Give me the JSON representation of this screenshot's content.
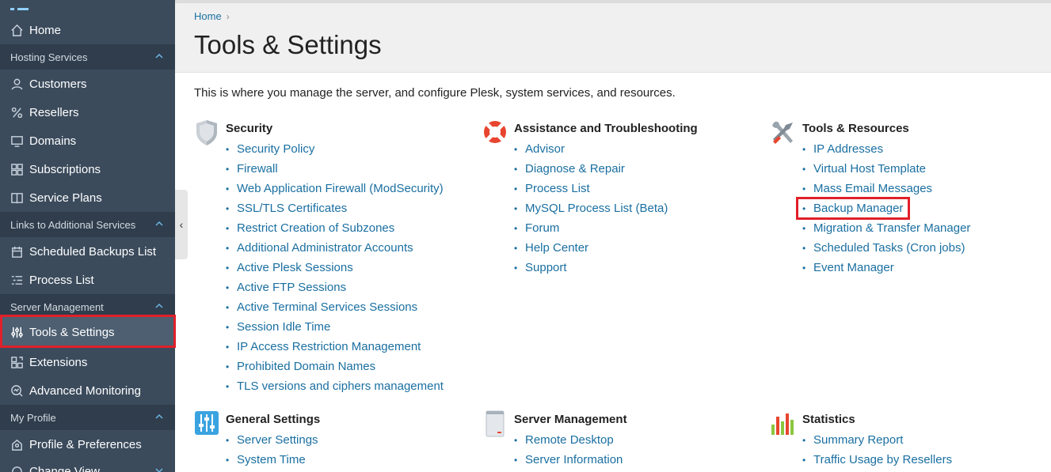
{
  "sidebar": {
    "items": [
      {
        "label": "Home",
        "icon": "home-icon"
      },
      {
        "group": "Hosting Services"
      },
      {
        "label": "Customers",
        "icon": "user-icon"
      },
      {
        "label": "Resellers",
        "icon": "percent-icon"
      },
      {
        "label": "Domains",
        "icon": "monitor-icon"
      },
      {
        "label": "Subscriptions",
        "icon": "grid-icon"
      },
      {
        "label": "Service Plans",
        "icon": "book-icon"
      },
      {
        "group": "Links to Additional Services"
      },
      {
        "label": "Scheduled Backups List",
        "icon": "backup-icon"
      },
      {
        "label": "Process List",
        "icon": "list-icon"
      },
      {
        "group": "Server Management"
      },
      {
        "label": "Tools & Settings",
        "icon": "sliders-icon",
        "active": true
      },
      {
        "label": "Extensions",
        "icon": "extensions-icon"
      },
      {
        "label": "Advanced Monitoring",
        "icon": "monitoring-icon"
      },
      {
        "group": "My Profile"
      },
      {
        "label": "Profile & Preferences",
        "icon": "profile-icon"
      },
      {
        "label": "Change View",
        "icon": "view-icon"
      }
    ],
    "collapse_handle": "‹"
  },
  "header": {
    "breadcrumb": "Home",
    "breadcrumb_sep": "›",
    "title": "Tools & Settings"
  },
  "intro": "This is where you manage the server, and configure Plesk, system services, and resources.",
  "sections": {
    "security": {
      "title": "Security",
      "icon": "shield-icon",
      "links": [
        "Security Policy",
        "Firewall",
        "Web Application Firewall (ModSecurity)",
        "SSL/TLS Certificates",
        "Restrict Creation of Subzones",
        "Additional Administrator Accounts",
        "Active Plesk Sessions",
        "Active FTP Sessions",
        "Active Terminal Services Sessions",
        "Session Idle Time",
        "IP Access Restriction Management",
        "Prohibited Domain Names",
        "TLS versions and ciphers management"
      ]
    },
    "assistance": {
      "title": "Assistance and Troubleshooting",
      "icon": "lifebuoy-icon",
      "links": [
        "Advisor",
        "Diagnose & Repair",
        "Process List",
        "MySQL Process List (Beta)",
        "Forum",
        "Help Center",
        "Support"
      ]
    },
    "tools": {
      "title": "Tools & Resources",
      "icon": "tools-icon",
      "links": [
        "IP Addresses",
        "Virtual Host Template",
        "Mass Email Messages",
        "Backup Manager",
        "Migration & Transfer Manager",
        "Scheduled Tasks (Cron jobs)",
        "Event Manager"
      ]
    },
    "general": {
      "title": "General Settings",
      "icon": "settings-sliders-icon",
      "links": [
        "Server Settings",
        "System Time"
      ]
    },
    "server": {
      "title": "Server Management",
      "icon": "server-icon",
      "links": [
        "Remote Desktop",
        "Server Information"
      ]
    },
    "statistics": {
      "title": "Statistics",
      "icon": "bar-chart-icon",
      "links": [
        "Summary Report",
        "Traffic Usage by Resellers"
      ]
    }
  },
  "colors": {
    "sidebar_bg": "#3b4b5c",
    "group_bg": "#2f3d4c",
    "link": "#1a6fa1",
    "highlight": "#e0202a"
  }
}
